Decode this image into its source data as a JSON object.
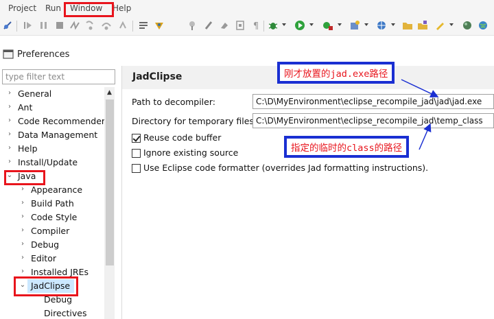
{
  "menu": {
    "items": [
      "Project",
      "Run",
      "Window",
      "Help"
    ]
  },
  "toolbar": {
    "icons": [
      "skip-breakpoints-icon",
      "resume-icon",
      "suspend-icon",
      "terminate-icon",
      "disconnect-icon",
      "step-into-icon",
      "step-over-icon",
      "step-return-icon",
      "console-icon",
      "jad-icon",
      "pin-icon",
      "marker-icon",
      "clear-icon",
      "brackets-icon",
      "pilcrow-icon",
      "debug-icon",
      "run-icon",
      "run-external-icon",
      "new-class-icon",
      "globe-icon",
      "folder-open-icon",
      "open-type-icon",
      "pen-icon",
      "sphere-icon",
      "world-icon"
    ]
  },
  "dialog": {
    "title": "Preferences"
  },
  "filter": {
    "placeholder": "type filter text"
  },
  "tree": {
    "items": [
      {
        "label": "General",
        "expanded": false,
        "level": 0
      },
      {
        "label": "Ant",
        "expanded": false,
        "level": 0
      },
      {
        "label": "Code Recommenders",
        "expanded": false,
        "level": 0
      },
      {
        "label": "Data Management",
        "expanded": false,
        "level": 0
      },
      {
        "label": "Help",
        "expanded": false,
        "level": 0
      },
      {
        "label": "Install/Update",
        "expanded": false,
        "level": 0
      },
      {
        "label": "Java",
        "expanded": true,
        "level": 0
      },
      {
        "label": "Appearance",
        "expanded": false,
        "level": 1
      },
      {
        "label": "Build Path",
        "expanded": false,
        "level": 1
      },
      {
        "label": "Code Style",
        "expanded": false,
        "level": 1
      },
      {
        "label": "Compiler",
        "expanded": false,
        "level": 1
      },
      {
        "label": "Debug",
        "expanded": false,
        "level": 1
      },
      {
        "label": "Editor",
        "expanded": false,
        "level": 1
      },
      {
        "label": "Installed JREs",
        "expanded": false,
        "level": 1
      },
      {
        "label": "JadClipse",
        "expanded": true,
        "level": 1,
        "selected": true
      },
      {
        "label": "Debug",
        "leaf": true,
        "level": 2
      },
      {
        "label": "Directives",
        "leaf": true,
        "level": 2
      }
    ]
  },
  "page": {
    "title": "JadClipse",
    "decompiler_label": "Path to decompiler:",
    "decompiler_value": "C:\\D\\MyEnvironment\\eclipse_recompile_jad\\jad\\jad.exe",
    "tempdir_label": "Directory for temporary files:",
    "tempdir_value": "C:\\D\\MyEnvironment\\eclipse_recompile_jad\\temp_class",
    "checkboxes": [
      {
        "label": "Reuse code buffer",
        "checked": true
      },
      {
        "label": "Ignore existing source",
        "checked": false
      },
      {
        "label": "Use Eclipse code formatter (overrides Jad formatting instructions).",
        "checked": false
      }
    ]
  },
  "annotations": {
    "callout_decompiler": {
      "prefix": "刚才放置的",
      "code": "jad.exe",
      "suffix": "路径"
    },
    "callout_temp": {
      "prefix": "指定的临时的",
      "code": "class",
      "suffix": "的路径"
    }
  },
  "colors": {
    "annotation_red": "#e8141c",
    "annotation_blue": "#1a2fd2",
    "selection": "#cce8ff"
  }
}
